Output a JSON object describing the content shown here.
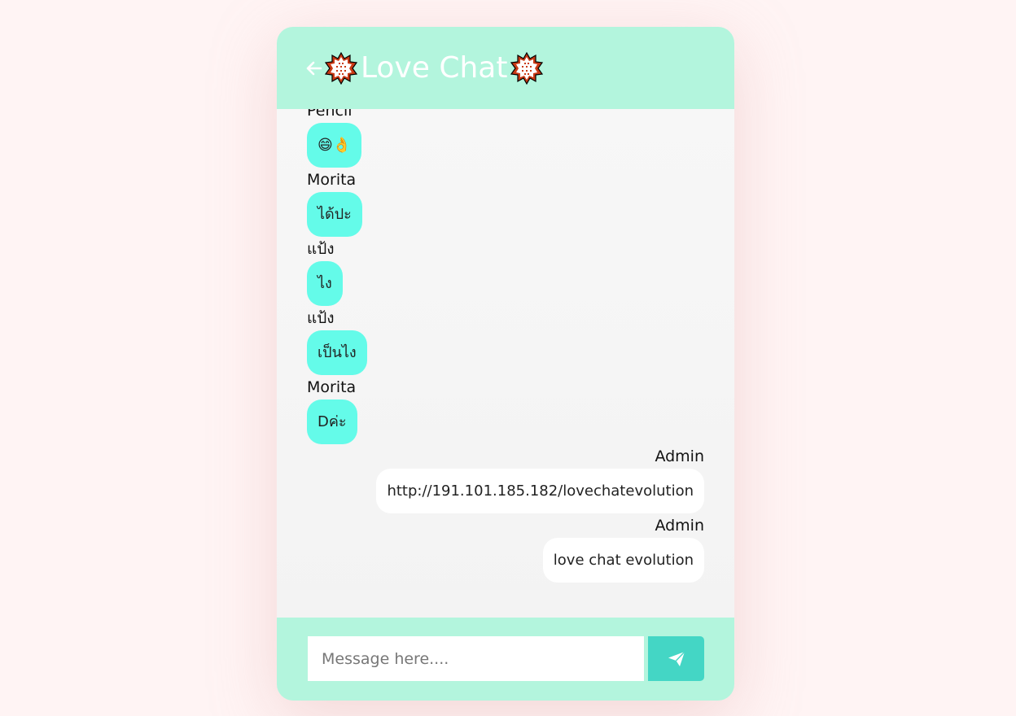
{
  "header": {
    "title": "Love Chat",
    "back_icon": "arrow-left-icon",
    "decor_icon": "flower-emblem-icon"
  },
  "messages": [
    {
      "side": "left",
      "sender": "Pencil",
      "text": "😄👌"
    },
    {
      "side": "left",
      "sender": "Morita",
      "text": "ได้ปะ"
    },
    {
      "side": "left",
      "sender": "แป้ง",
      "text": "ไง"
    },
    {
      "side": "left",
      "sender": "แป้ง",
      "text": "เป็นไง"
    },
    {
      "side": "left",
      "sender": "Morita",
      "text": "Dค่ะ"
    },
    {
      "side": "right",
      "sender": "Admin",
      "text": "http://191.101.185.182/lovechatevolution"
    },
    {
      "side": "right",
      "sender": "Admin",
      "text": "love chat evolution"
    }
  ],
  "composer": {
    "placeholder": "Message here....",
    "value": "",
    "send_icon": "paper-plane-icon"
  },
  "colors": {
    "header_bg": "#b3f5dd",
    "incoming_bubble": "#64fbe9",
    "outgoing_bubble": "#ffffff",
    "send_button": "#44d6c5",
    "page_bg": "#fff4f4"
  }
}
